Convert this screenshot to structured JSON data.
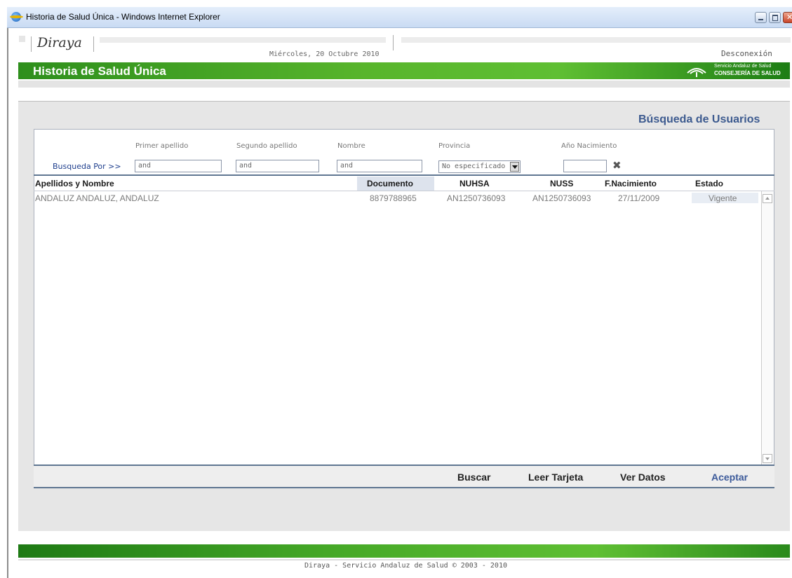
{
  "window": {
    "title": "Historia de Salud Única - Windows Internet Explorer"
  },
  "header": {
    "logo": "Diraya",
    "date": "Miércoles, 20 Octubre 2010",
    "logout": "Desconexión",
    "app_title": "Historia de Salud Única",
    "org_line1": "Servicio Andaluz de Salud",
    "org_line2": "CONSEJERÍA DE SALUD"
  },
  "search": {
    "section_title": "Búsqueda de Usuarios",
    "search_by": "Busqueda Por >>",
    "labels": {
      "primer_apellido": "Primer apellido",
      "segundo_apellido": "Segundo apellido",
      "nombre": "Nombre",
      "provincia": "Provincia",
      "ano": "Año Nacimiento"
    },
    "values": {
      "primer_apellido": "and",
      "segundo_apellido": "and",
      "nombre": "and",
      "provincia": "No especificado",
      "ano": ""
    }
  },
  "table": {
    "columns": [
      "Apellidos y Nombre",
      "Documento",
      "NUHSA",
      "NUSS",
      "F.Nacimiento",
      "Estado"
    ],
    "rows": [
      {
        "nombre": "ANDALUZ ANDALUZ, ANDALUZ",
        "documento": "8879788965",
        "nuhsa": "AN1250736093",
        "nuss": "AN1250736093",
        "fnac": "27/11/2009",
        "estado": "Vigente"
      }
    ]
  },
  "buttons": {
    "buscar": "Buscar",
    "leer_tarjeta": "Leer Tarjeta",
    "ver_datos": "Ver Datos",
    "aceptar": "Aceptar"
  },
  "footer": {
    "copyright": "Diraya - Servicio Andaluz de Salud © 2003 - 2010"
  },
  "colors": {
    "brand_green": "#58b52c",
    "link_blue": "#3c5a8f"
  },
  "icons": [
    "ie-icon",
    "minimize-icon",
    "maximize-icon",
    "close-icon",
    "clear-icon",
    "dropdown-arrow-icon",
    "scroll-up-icon",
    "scroll-down-icon",
    "sas-logo-icon"
  ]
}
